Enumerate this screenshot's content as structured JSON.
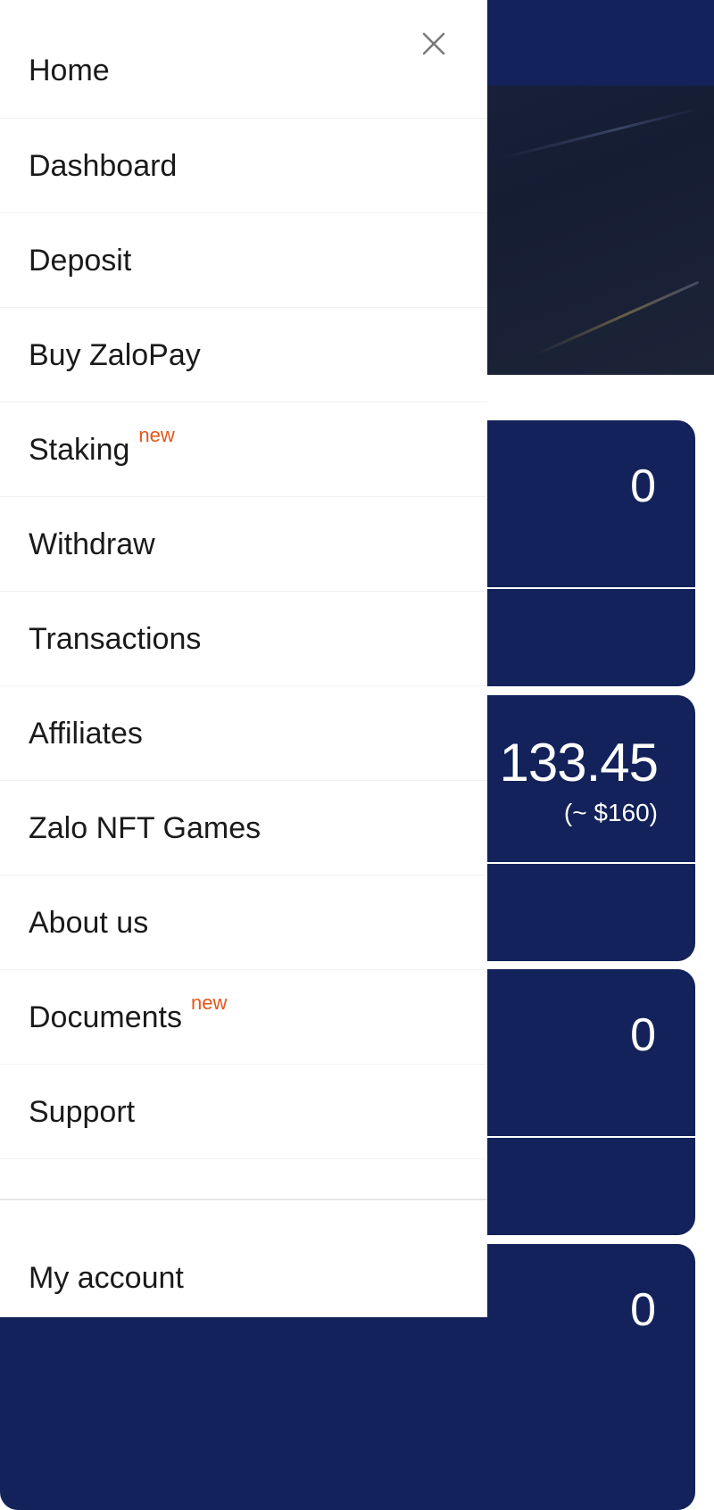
{
  "drawer": {
    "close_icon": "close-icon",
    "menu": [
      {
        "id": "home",
        "label": "Home",
        "badge": ""
      },
      {
        "id": "dashboard",
        "label": "Dashboard",
        "badge": ""
      },
      {
        "id": "deposit",
        "label": "Deposit",
        "badge": ""
      },
      {
        "id": "buy-zalopay",
        "label": "Buy ZaloPay",
        "badge": ""
      },
      {
        "id": "staking",
        "label": "Staking",
        "badge": "new"
      },
      {
        "id": "withdraw",
        "label": "Withdraw",
        "badge": ""
      },
      {
        "id": "transactions",
        "label": "Transactions",
        "badge": ""
      },
      {
        "id": "affiliates",
        "label": "Affiliates",
        "badge": ""
      },
      {
        "id": "zalo-nft-games",
        "label": "Zalo NFT Games",
        "badge": ""
      },
      {
        "id": "about-us",
        "label": "About us",
        "badge": ""
      },
      {
        "id": "documents",
        "label": "Documents",
        "badge": "new"
      },
      {
        "id": "support",
        "label": "Support",
        "badge": ""
      }
    ],
    "account": {
      "label": "My account"
    }
  },
  "background": {
    "cards": [
      {
        "value": "0",
        "sub": ""
      },
      {
        "value": "133.45",
        "sub": "(~ $160)"
      },
      {
        "value": "0",
        "sub": ""
      },
      {
        "value": "0",
        "sub": ""
      }
    ]
  },
  "colors": {
    "navy": "#13225a",
    "badge": "#e5561a",
    "text": "#1a1a1a"
  }
}
